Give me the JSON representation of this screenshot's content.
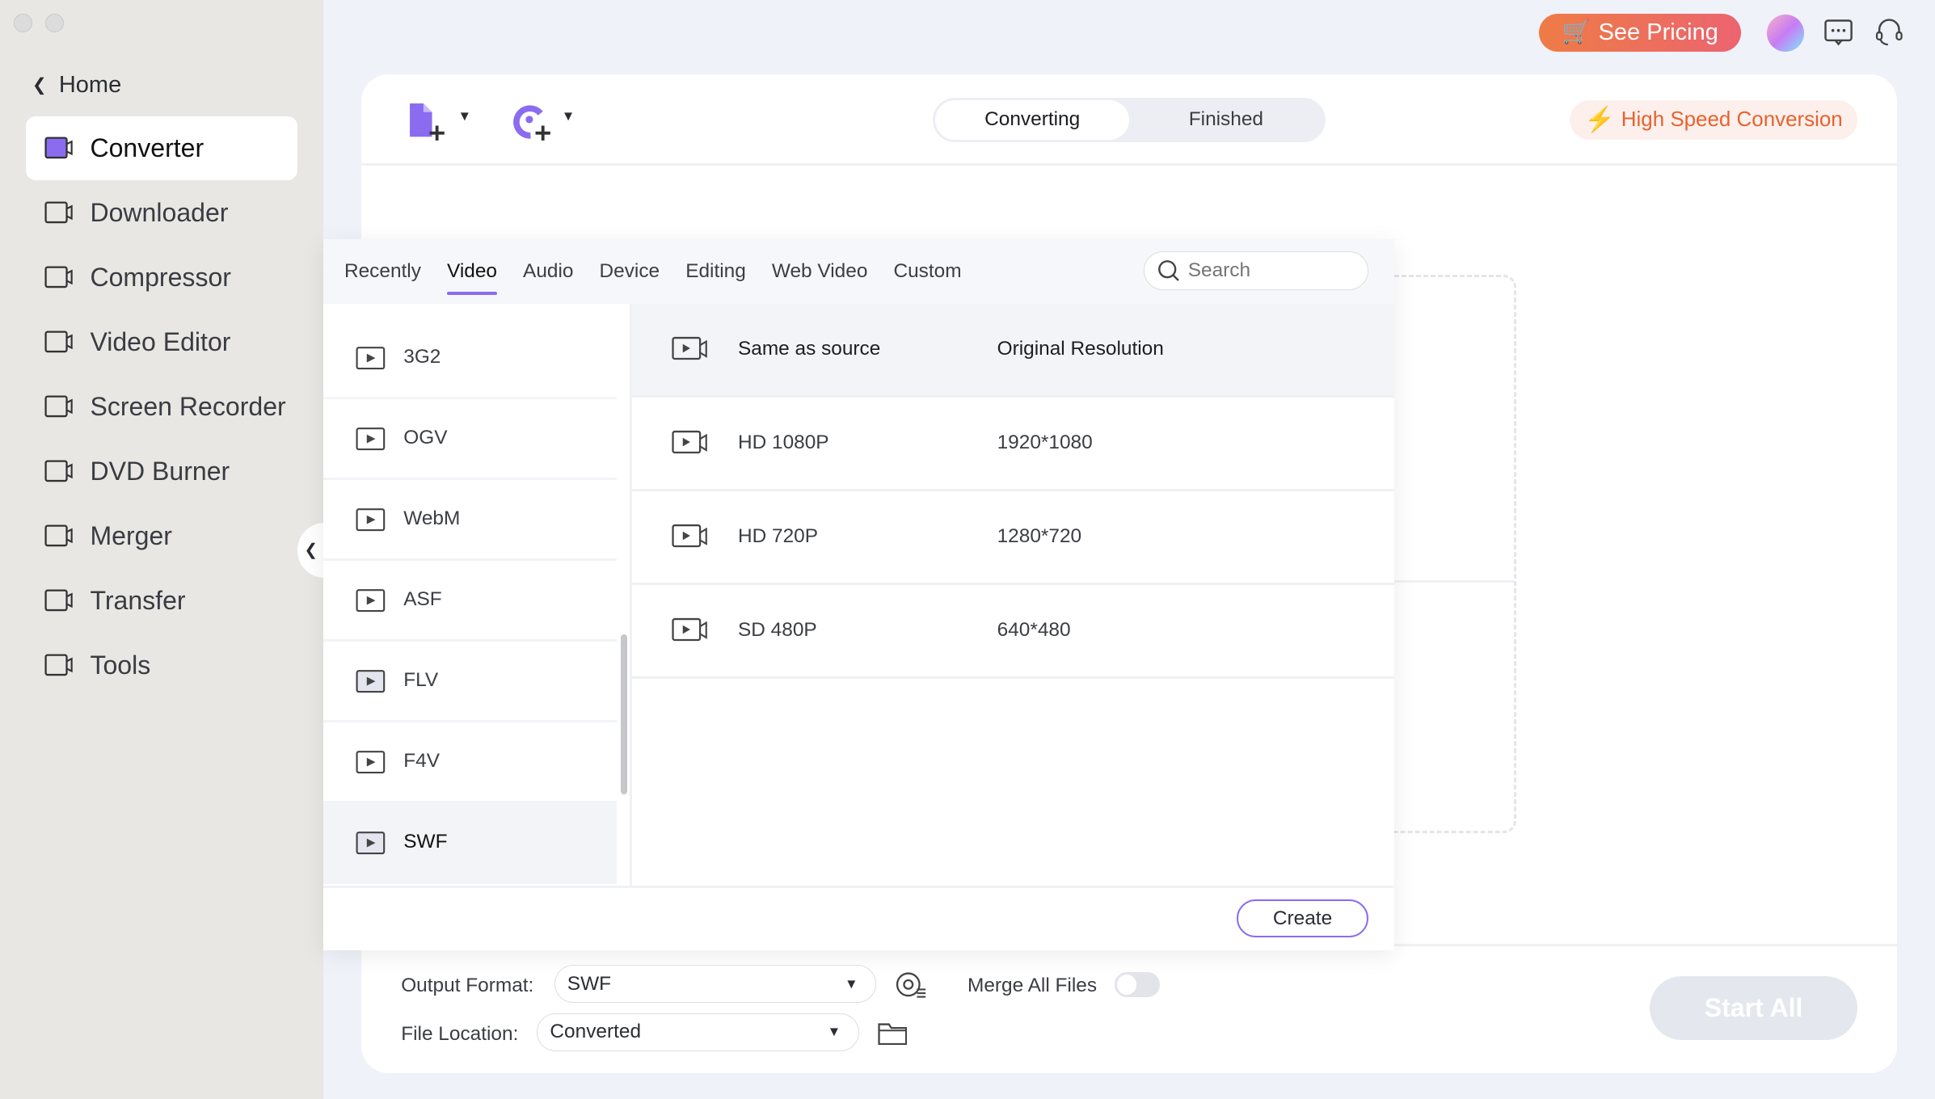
{
  "sidebar": {
    "home": "Home",
    "items": [
      {
        "label": "Converter",
        "icon": "converter-icon"
      },
      {
        "label": "Downloader",
        "icon": "download-icon"
      },
      {
        "label": "Compressor",
        "icon": "compress-icon"
      },
      {
        "label": "Video Editor",
        "icon": "scissors-icon"
      },
      {
        "label": "Screen Recorder",
        "icon": "record-icon"
      },
      {
        "label": "DVD Burner",
        "icon": "disc-icon"
      },
      {
        "label": "Merger",
        "icon": "merge-icon"
      },
      {
        "label": "Transfer",
        "icon": "transfer-icon"
      },
      {
        "label": "Tools",
        "icon": "grid-icon"
      }
    ]
  },
  "topbar": {
    "pricing": "See Pricing"
  },
  "toolbar": {
    "tabs": [
      "Converting",
      "Finished"
    ],
    "active_tab": "Converting",
    "high_speed": "High Speed Conversion"
  },
  "popup": {
    "tabs": [
      "Recently",
      "Video",
      "Audio",
      "Device",
      "Editing",
      "Web Video",
      "Custom"
    ],
    "active_tab": "Video",
    "search_placeholder": "Search",
    "formats": [
      "3G2",
      "OGV",
      "WebM",
      "ASF",
      "FLV",
      "F4V",
      "SWF"
    ],
    "selected_format": "SWF",
    "resolutions": [
      {
        "name": "Same as source",
        "value": "Original Resolution"
      },
      {
        "name": "HD 1080P",
        "value": "1920*1080"
      },
      {
        "name": "HD 720P",
        "value": "1280*720"
      },
      {
        "name": "SD 480P",
        "value": "640*480"
      }
    ],
    "create": "Create"
  },
  "footer": {
    "output_label": "Output Format:",
    "output_value": "SWF",
    "merge_label": "Merge All Files",
    "merge_on": false,
    "location_label": "File Location:",
    "location_value": "Converted",
    "start_all": "Start All"
  },
  "colors": {
    "accent": "#8b6cf0",
    "orange": "#e8622e"
  }
}
